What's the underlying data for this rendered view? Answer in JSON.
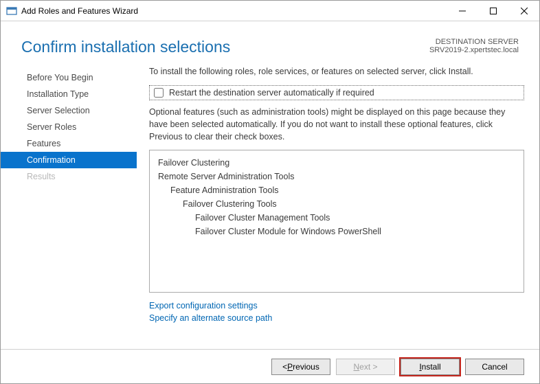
{
  "window": {
    "title": "Add Roles and Features Wizard"
  },
  "header": {
    "page_title": "Confirm installation selections",
    "destination_label": "DESTINATION SERVER",
    "destination_value": "SRV2019-2.xpertstec.local"
  },
  "sidebar": {
    "items": [
      {
        "label": "Before You Begin",
        "active": false,
        "disabled": false
      },
      {
        "label": "Installation Type",
        "active": false,
        "disabled": false
      },
      {
        "label": "Server Selection",
        "active": false,
        "disabled": false
      },
      {
        "label": "Server Roles",
        "active": false,
        "disabled": false
      },
      {
        "label": "Features",
        "active": false,
        "disabled": false
      },
      {
        "label": "Confirmation",
        "active": true,
        "disabled": false
      },
      {
        "label": "Results",
        "active": false,
        "disabled": true
      }
    ]
  },
  "content": {
    "instruction": "To install the following roles, role services, or features on selected server, click Install.",
    "restart_label": "Restart the destination server automatically if required",
    "optional_text": "Optional features (such as administration tools) might be displayed on this page because they have been selected automatically. If you do not want to install these optional features, click Previous to clear their check boxes.",
    "features": [
      {
        "label": "Failover Clustering",
        "indent": 0
      },
      {
        "label": "Remote Server Administration Tools",
        "indent": 0
      },
      {
        "label": "Feature Administration Tools",
        "indent": 1
      },
      {
        "label": "Failover Clustering Tools",
        "indent": 2
      },
      {
        "label": "Failover Cluster Management Tools",
        "indent": 3
      },
      {
        "label": "Failover Cluster Module for Windows PowerShell",
        "indent": 3
      }
    ],
    "export_link": "Export configuration settings",
    "source_link": "Specify an alternate source path"
  },
  "footer": {
    "previous": "Previous",
    "next": "Next >",
    "install": "Install",
    "cancel": "Cancel"
  }
}
